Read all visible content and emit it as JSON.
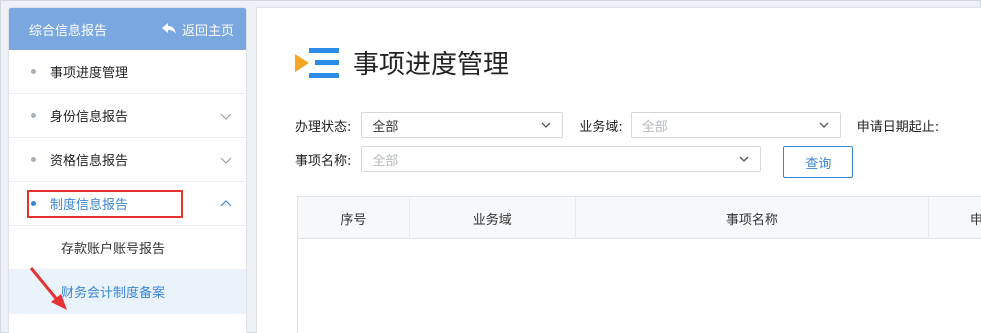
{
  "sidebar": {
    "header_title": "综合信息报告",
    "home_label": "返回主页",
    "items": [
      {
        "label": "事项进度管理",
        "has_chevron": false
      },
      {
        "label": "身份信息报告",
        "has_chevron": true
      },
      {
        "label": "资格信息报告",
        "has_chevron": true
      },
      {
        "label": "制度信息报告",
        "has_chevron": true,
        "expanded": true
      }
    ],
    "sub_items": [
      {
        "label": "存款账户账号报告"
      },
      {
        "label": "财务会计制度备案",
        "selected": true
      }
    ]
  },
  "main": {
    "title": "事项进度管理",
    "filters": {
      "status_label": "办理状态:",
      "status_value": "全部",
      "domain_label": "业务域:",
      "domain_value": "全部",
      "date_label": "申请日期起止:",
      "name_label": "事项名称:",
      "name_value": "全部",
      "query_button": "查询"
    },
    "table": {
      "columns": [
        "序号",
        "业务域",
        "事项名称",
        "申"
      ]
    }
  },
  "colors": {
    "accent": "#3a86d6",
    "sidebar_header": "#7aa7e0",
    "highlight_box": "#e53333",
    "icon_blue": "#2b8be6",
    "icon_orange": "#f5a623"
  },
  "icons": {
    "home": "reply-arrow-icon",
    "title": "list-menu-icon",
    "dropdown": "chevron-down-icon"
  }
}
